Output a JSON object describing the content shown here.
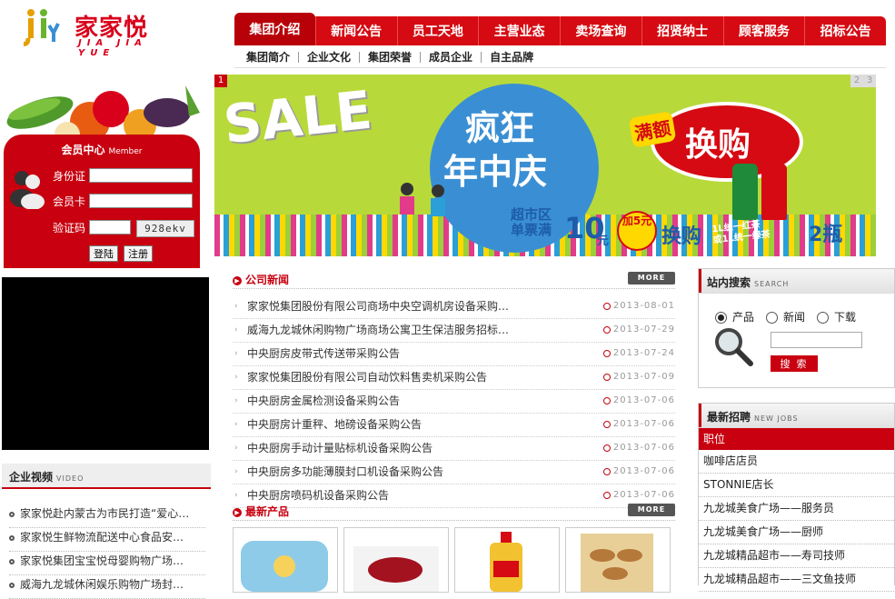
{
  "brand": {
    "name": "家家悦",
    "en": "JIA JIA YUE"
  },
  "nav": [
    "集团介绍",
    "新闻公告",
    "员工天地",
    "主营业态",
    "卖场查询",
    "招贤纳士",
    "顾客服务",
    "招标公告"
  ],
  "subnav": [
    "集团简介",
    "企业文化",
    "集团荣誉",
    "成员企业",
    "自主品牌"
  ],
  "member": {
    "title": "会员中心",
    "title_en": "Member",
    "id_label": "身份证",
    "card_label": "会员卡",
    "code_label": "验证码",
    "captcha": "928ekv",
    "login": "登陆",
    "register": "注册"
  },
  "banner": {
    "pages": [
      "1",
      "2",
      "3"
    ],
    "sale": "SALE",
    "headline1": "疯狂",
    "headline2": "年中庆",
    "tag": "满额",
    "exchange": "换购",
    "promo1": "超市区",
    "promo2": "单票满",
    "amount": "10",
    "yuan": "元",
    "add": "加5元",
    "swap": "换购",
    "tea1": "1L统一红茶",
    "tea2": "或1L统一绿茶",
    "qty": "2瓶"
  },
  "video": {
    "title": "企业视频",
    "title_en": "VIDEO",
    "items": [
      "家家悦赴内蒙古为市民打造“爱心…",
      "家家悦生鲜物流配送中心食品安…",
      "家家悦集团宝宝悦母婴购物广场…",
      "威海九龙城休闲娱乐购物广场封…"
    ]
  },
  "news": {
    "title": "公司新闻",
    "more": "MORE",
    "items": [
      {
        "title": "家家悦集团股份有限公司商场中央空调机房设备采购…",
        "date": "2013-08-01"
      },
      {
        "title": "威海九龙城休闲购物广场商场公寓卫生保洁服务招标…",
        "date": "2013-07-29"
      },
      {
        "title": "中央厨房皮带式传送带采购公告",
        "date": "2013-07-24"
      },
      {
        "title": "家家悦集团股份有限公司自动饮料售卖机采购公告",
        "date": "2013-07-09"
      },
      {
        "title": "中央厨房金属检测设备采购公告",
        "date": "2013-07-06"
      },
      {
        "title": "中央厨房计重秤、地磅设备采购公告",
        "date": "2013-07-06"
      },
      {
        "title": "中央厨房手动计量贴标机设备采购公告",
        "date": "2013-07-06"
      },
      {
        "title": "中央厨房多功能薄膜封口机设备采购公告",
        "date": "2013-07-06"
      },
      {
        "title": "中央厨房喷码机设备采购公告",
        "date": "2013-07-06"
      }
    ]
  },
  "products": {
    "title": "最新产品",
    "more": "MORE"
  },
  "search": {
    "title": "站内搜索",
    "title_en": "SEARCH",
    "options": [
      "产品",
      "新闻",
      "下载"
    ],
    "selected": "产品",
    "button": "搜 索"
  },
  "jobs": {
    "title": "最新招聘",
    "title_en": "NEW JOBS",
    "header": "职位",
    "items": [
      "咖啡店店员",
      "STONNIE店长",
      "九龙城美食广场——服务员",
      "九龙城美食广场——厨师",
      "九龙城精品超市——寿司技师",
      "九龙城精品超市——三文鱼技师"
    ]
  },
  "colors": {
    "brand_red": "#c8000f",
    "nav_red": "#d50a12",
    "logo_orange": "#e4a000"
  }
}
